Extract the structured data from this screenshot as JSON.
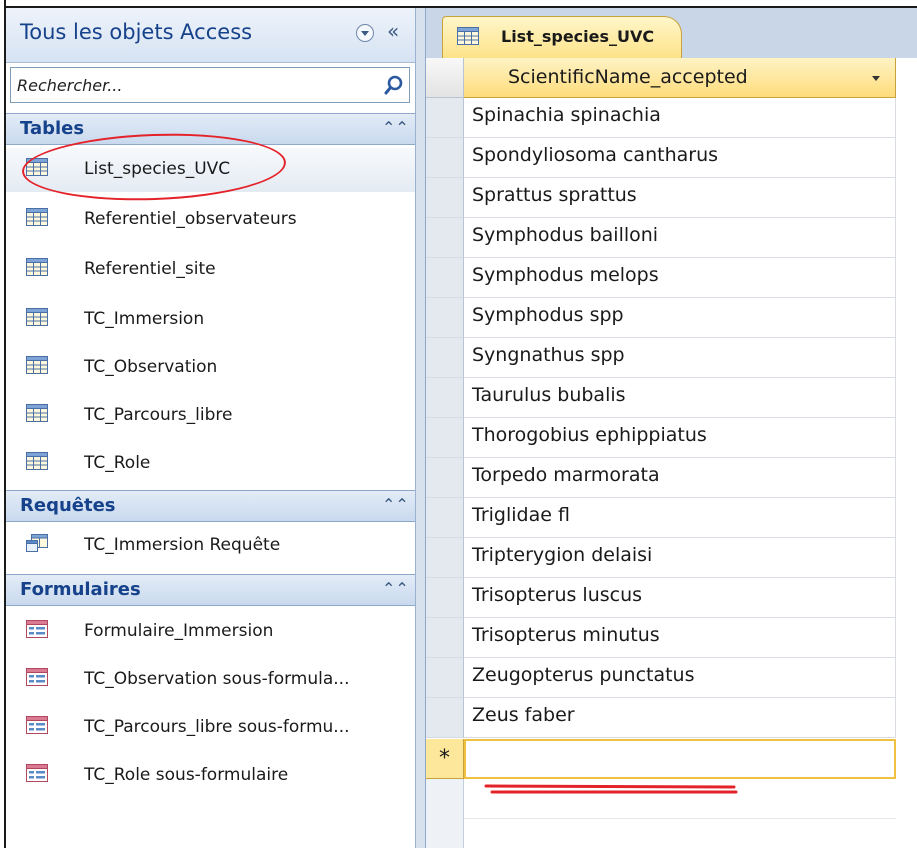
{
  "nav": {
    "title": "Tous les objets Access",
    "search_placeholder": "Rechercher...",
    "groups": [
      {
        "title": "Tables",
        "items": [
          {
            "label": "List_species_UVC",
            "type": "table",
            "selected": true
          },
          {
            "label": "Referentiel_observateurs",
            "type": "table"
          },
          {
            "label": "Referentiel_site",
            "type": "table"
          },
          {
            "label": "TC_Immersion",
            "type": "table"
          },
          {
            "label": "TC_Observation",
            "type": "table"
          },
          {
            "label": "TC_Parcours_libre",
            "type": "table"
          },
          {
            "label": "TC_Role",
            "type": "table"
          }
        ]
      },
      {
        "title": "Requêtes",
        "items": [
          {
            "label": "TC_Immersion Requête",
            "type": "query"
          }
        ]
      },
      {
        "title": "Formulaires",
        "items": [
          {
            "label": "Formulaire_Immersion",
            "type": "form"
          },
          {
            "label": "TC_Observation sous-formula...",
            "type": "form"
          },
          {
            "label": "TC_Parcours_libre sous-formu...",
            "type": "form"
          },
          {
            "label": "TC_Role sous-formulaire",
            "type": "form"
          }
        ]
      }
    ]
  },
  "document": {
    "tab_label": "List_species_UVC",
    "column_header": "ScientificName_accepted",
    "rows": [
      "Spinachia spinachia",
      "Spondyliosoma cantharus",
      "Sprattus sprattus",
      "Symphodus bailloni",
      "Symphodus melops",
      "Symphodus spp",
      "Syngnathus spp",
      "Taurulus bubalis",
      "Thorogobius ephippiatus",
      "Torpedo marmorata",
      "Triglidae fl",
      "Tripterygion delaisi",
      "Trisopterus luscus",
      "Trisopterus minutus",
      "Zeugopterus punctatus",
      "Zeus faber"
    ],
    "new_record_marker": "*"
  },
  "colors": {
    "accent_blue": "#15428b",
    "annotation_red": "#e4222a",
    "active_yellow": "#fde389"
  },
  "icons": {
    "nav_dropdown": "chevron-down-icon",
    "nav_collapse": "double-chevron-left-icon",
    "search": "search-icon",
    "table": "table-icon",
    "query": "query-icon",
    "form": "form-icon",
    "group_collapse": "double-chevron-up-icon"
  }
}
